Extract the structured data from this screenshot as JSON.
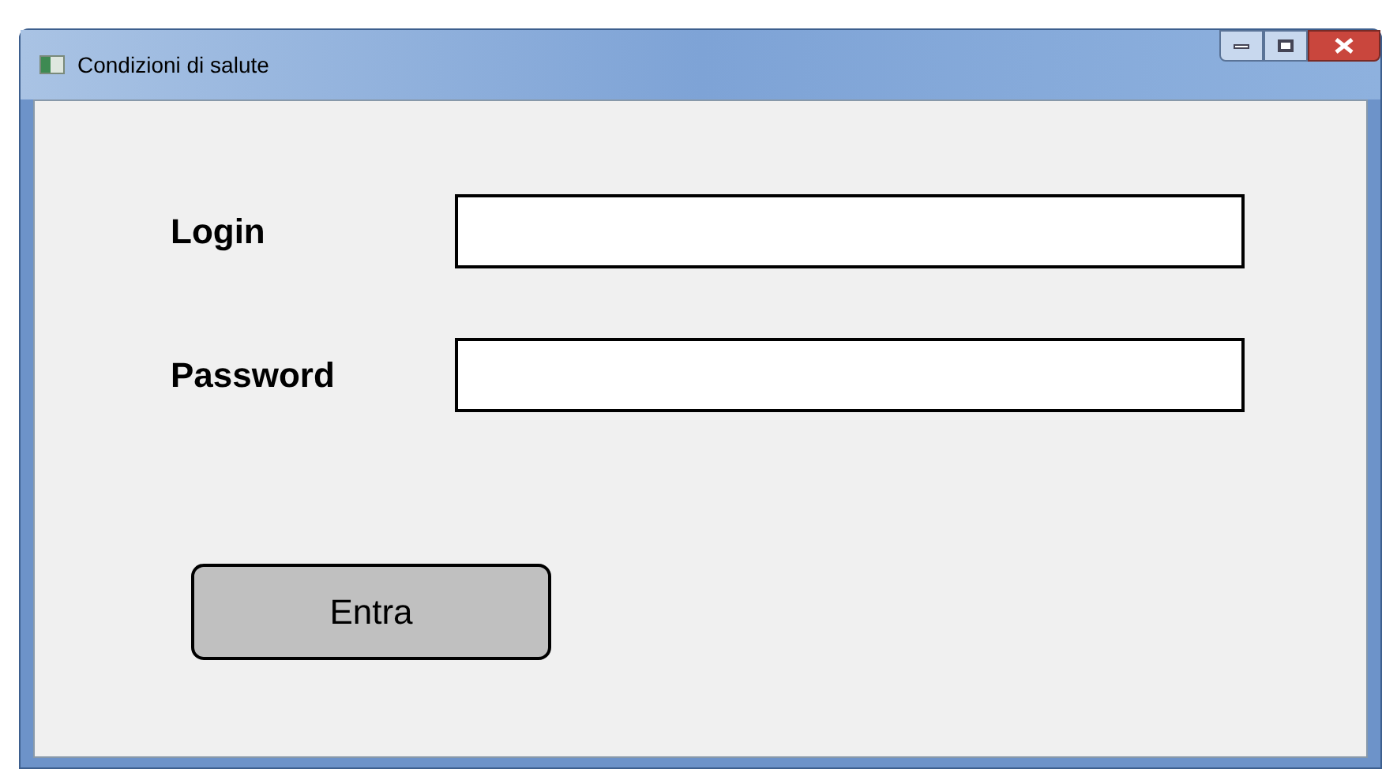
{
  "window": {
    "title": "Condizioni di salute"
  },
  "fields": [
    {
      "label": "Login"
    },
    {
      "label": "Password"
    }
  ],
  "button": {
    "label": "Entra"
  }
}
